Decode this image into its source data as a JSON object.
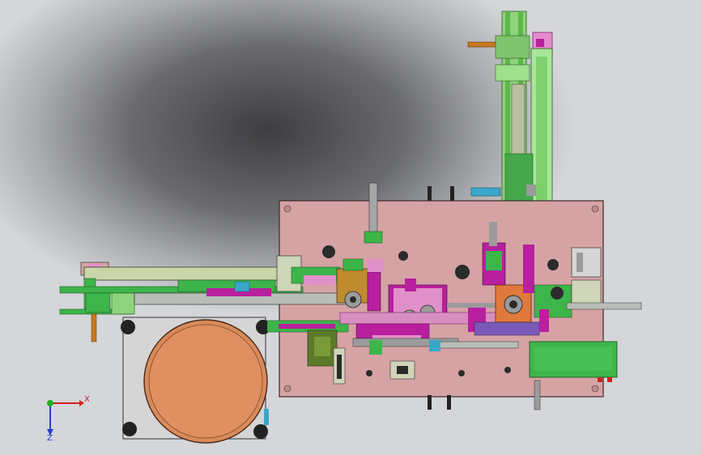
{
  "viewport": {
    "background_dark": "#3e3e40",
    "background_light": "#d4d6d9"
  },
  "model": {
    "base_plate_color": "#d6a3a5",
    "pink_color": "#d98ec2",
    "magenta_color": "#b8209e",
    "green_color": "#3db54a",
    "light_green_color": "#8ed37c",
    "orange_color": "#e07a3c",
    "copper_color": "#d98a5a",
    "grey_color": "#9b9b9b",
    "blue_color": "#3aa6c8"
  },
  "triad": {
    "x_label": "X",
    "z_label": "Z",
    "x_color": "#d42020",
    "z_color": "#2040d0",
    "y_color": "#20b020"
  },
  "icons": {
    "triad": "coordinate-triad-icon"
  }
}
